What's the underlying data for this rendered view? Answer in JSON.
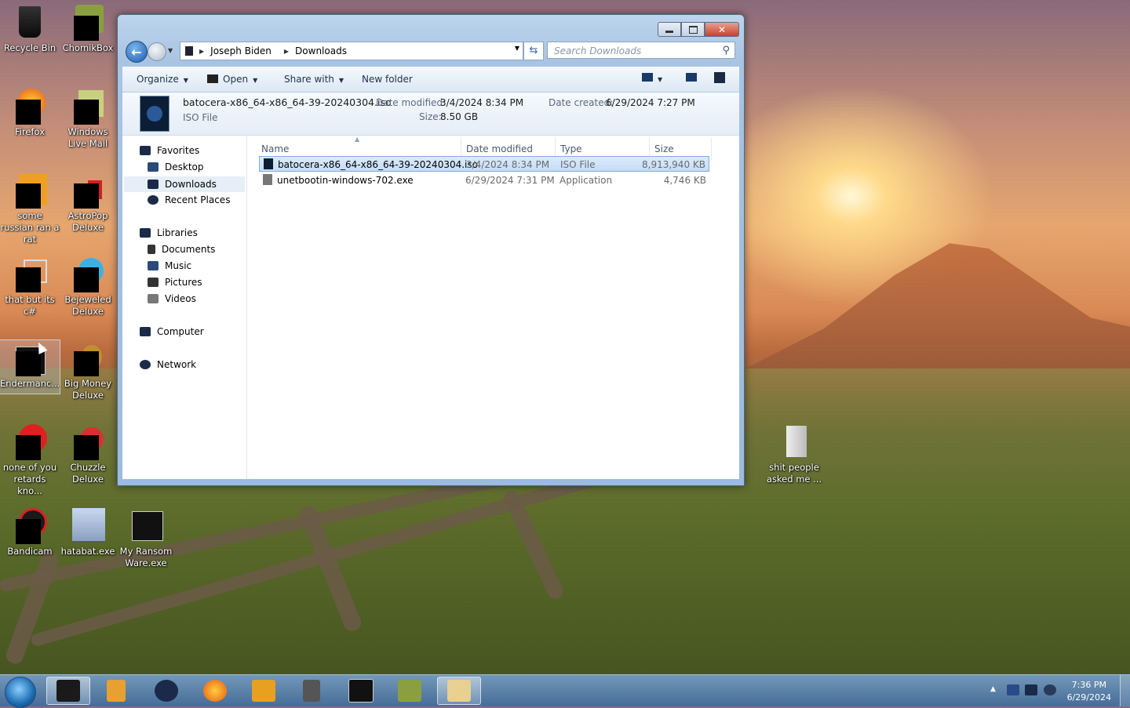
{
  "desktop": {
    "icons": [
      {
        "label": "Recycle Bin"
      },
      {
        "label": "ChomikBox"
      },
      {
        "label": "Firefox"
      },
      {
        "label": "Windows Live Mail"
      },
      {
        "label": "some russian ran a rat"
      },
      {
        "label": "AstroPop Deluxe"
      },
      {
        "label": "that but its c#"
      },
      {
        "label": "Bejeweled Deluxe"
      },
      {
        "label": "Endermanc..."
      },
      {
        "label": "Big Money Deluxe"
      },
      {
        "label": "none of you retards kno..."
      },
      {
        "label": "Chuzzle Deluxe"
      },
      {
        "label": "Bandicam"
      },
      {
        "label": "hatabat.exe"
      },
      {
        "label": "My Ransom Ware.exe"
      },
      {
        "label": "shit people asked me ..."
      }
    ]
  },
  "window": {
    "breadcrumb": [
      "Joseph Biden",
      "Downloads"
    ],
    "search_placeholder": "Search Downloads",
    "toolbar": {
      "organize": "Organize",
      "open": "Open",
      "share_with": "Share with",
      "new_folder": "New folder"
    },
    "details": {
      "filename": "batocera-x86_64-x86_64-39-20240304.iso",
      "filetype": "ISO File",
      "date_modified_label": "Date modified:",
      "date_modified": "3/4/2024 8:34 PM",
      "size_label": "Size:",
      "size": "8.50 GB",
      "date_created_label": "Date created:",
      "date_created": "6/29/2024 7:27 PM"
    },
    "nav": {
      "favorites": "Favorites",
      "desktop": "Desktop",
      "downloads": "Downloads",
      "recent": "Recent Places",
      "libraries": "Libraries",
      "documents": "Documents",
      "music": "Music",
      "pictures": "Pictures",
      "videos": "Videos",
      "computer": "Computer",
      "network": "Network"
    },
    "columns": {
      "name": "Name",
      "date_modified": "Date modified",
      "type": "Type",
      "size": "Size"
    },
    "files": [
      {
        "name": "batocera-x86_64-x86_64-39-20240304.iso",
        "date": "3/4/2024 8:34 PM",
        "type": "ISO File",
        "size": "8,913,940 KB"
      },
      {
        "name": "unetbootin-windows-702.exe",
        "date": "6/29/2024 7:31 PM",
        "type": "Application",
        "size": "4,746 KB"
      }
    ]
  },
  "taskbar": {
    "time": "7:36 PM",
    "date": "6/29/2024"
  },
  "colors": {
    "accent": "#1e5ca8",
    "selection": "#c4dcf6",
    "close_button": "#c8402c"
  }
}
